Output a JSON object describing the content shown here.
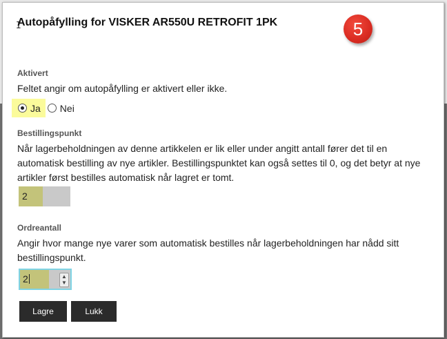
{
  "dialog": {
    "title": "Autopåfylling for VISKER AR550U RETROFIT 1PK",
    "step_badge": "5"
  },
  "aktivert": {
    "label": "Aktivert",
    "description": "Feltet angir om autopåfylling er aktivert eller ikke.",
    "options": [
      {
        "label": "Ja",
        "checked": true
      },
      {
        "label": "Nei",
        "checked": false
      }
    ]
  },
  "bestillingspunkt": {
    "label": "Bestillingspunkt",
    "description": "Når lagerbeholdningen av denne artikkelen er lik eller under angitt antall fører det til en automatisk bestilling av nye artikler. Bestillingspunktet kan også settes til 0, og det betyr at nye artikler først bestilles automatisk når lagret er tomt.",
    "value": "2"
  },
  "ordreantall": {
    "label": "Ordreantall",
    "description": "Angir hvor mange nye varer som automatisk bestilles når lagerbeholdningen har nådd sitt bestillingspunkt.",
    "value": "2"
  },
  "buttons": {
    "save": "Lagre",
    "close": "Lukk"
  },
  "icons": {
    "spin_up": "chevron-up-icon",
    "spin_down": "chevron-down-icon"
  },
  "colors": {
    "badge": "#d92b21",
    "highlight_yellow": "#fbfb9b",
    "field_highlight": "#c3c37a",
    "focus_border": "#7fd3e4",
    "button_bg": "#2b2b2b"
  }
}
